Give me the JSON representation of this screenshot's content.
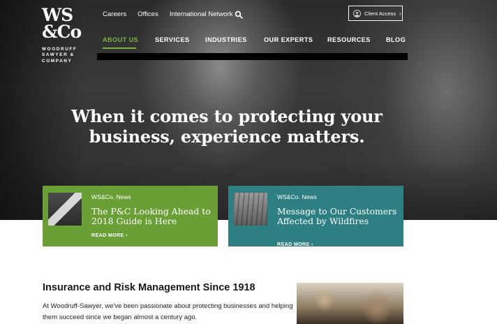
{
  "brand": {
    "logo_mark_line1": "WS",
    "logo_mark_line2": "&Co",
    "logo_tag": "WOODRUFF SAWYER & COMPANY"
  },
  "utility_nav": {
    "items": [
      "Careers",
      "Offices",
      "International Network"
    ],
    "search_icon": "search-icon"
  },
  "client_access": {
    "label": "Client Access",
    "icon": "user-icon",
    "chevron": "›"
  },
  "main_nav": {
    "items": [
      "ABOUT US",
      "SERVICES",
      "INDUSTRIES",
      "OUR EXPERTS",
      "RESOURCES",
      "BLOG"
    ],
    "active": "ABOUT US"
  },
  "hero": {
    "headline_line1": "When it comes to protecting your",
    "headline_line2": "business, experience matters."
  },
  "cards": [
    {
      "kicker": "WS&Co. News",
      "title": "The P&C Looking Ahead to 2018 Guide is Here",
      "more": "READ MORE  ›",
      "color": "#6a9f35"
    },
    {
      "kicker": "WS&Co. News",
      "title": "Message to Our Customers Affected by Wildfires",
      "more": "READ MORE  ›",
      "color": "#2d7f82"
    }
  ],
  "intro": {
    "title": "Insurance and Risk Management Since 1918",
    "text": "At Woodruff-Sawyer, we've been passionate about protecting businesses and helping them succeed since we began almost a century ago."
  },
  "colors": {
    "accent_green": "#7bb341",
    "card_green": "#6a9f35",
    "card_teal": "#2d7f82"
  }
}
